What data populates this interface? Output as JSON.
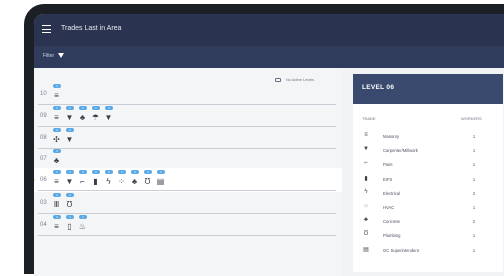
{
  "header": {
    "title": "Trades Last in Area"
  },
  "filter": {
    "label": "Filter",
    "icon": "filter-icon"
  },
  "legend": {
    "no_work_label": "No Active Levels",
    "icon": "no-work-icon"
  },
  "accent": {
    "marker": "#f2a516",
    "badge": "#5aa9e6",
    "header": "#2a3451"
  },
  "floors": [
    {
      "level": "10",
      "active": false,
      "trades": [
        {
          "count": "1",
          "glyph": "≡",
          "icon": "masonry-icon"
        }
      ]
    },
    {
      "level": "09",
      "active": false,
      "trades": [
        {
          "count": "1",
          "glyph": "≡",
          "icon": "masonry-icon"
        },
        {
          "count": "1",
          "glyph": "▼",
          "icon": "carpenter-icon"
        },
        {
          "count": "1",
          "glyph": "♣",
          "icon": "concrete-icon"
        },
        {
          "count": "1",
          "glyph": "☂",
          "icon": "hvac-icon"
        },
        {
          "count": "1",
          "glyph": "▼",
          "icon": "carpenter-icon"
        }
      ]
    },
    {
      "level": "08",
      "active": false,
      "trades": [
        {
          "count": "1",
          "glyph": "✣",
          "icon": "hvac-icon"
        },
        {
          "count": "1",
          "glyph": "▼",
          "icon": "carpenter-icon"
        }
      ]
    },
    {
      "level": "07",
      "active": false,
      "trades": [
        {
          "count": "1",
          "glyph": "♣",
          "icon": "concrete-icon"
        }
      ]
    },
    {
      "level": "06",
      "active": true,
      "trades": [
        {
          "count": "1",
          "glyph": "≡",
          "icon": "masonry-icon"
        },
        {
          "count": "1",
          "glyph": "▼",
          "icon": "carpenter-icon"
        },
        {
          "count": "1",
          "glyph": "⌐",
          "icon": "paint-icon"
        },
        {
          "count": "1",
          "glyph": "▮",
          "icon": "eifs-icon"
        },
        {
          "count": "2",
          "glyph": "ϟ",
          "icon": "electrical-icon"
        },
        {
          "count": "1",
          "glyph": "⁘",
          "icon": "hvac-icon"
        },
        {
          "count": "2",
          "glyph": "♣",
          "icon": "concrete-icon"
        },
        {
          "count": "1",
          "glyph": "Ʊ",
          "icon": "plumbing-icon"
        },
        {
          "count": "1",
          "glyph": "▤",
          "icon": "superintendent-icon"
        }
      ]
    },
    {
      "level": "03",
      "active": false,
      "trades": [
        {
          "count": "1",
          "glyph": "Ⅲ",
          "icon": "scaffold-icon"
        },
        {
          "count": "1",
          "glyph": "Ʊ",
          "icon": "plumbing-icon"
        }
      ]
    },
    {
      "level": "04",
      "active": false,
      "trades": [
        {
          "count": "1",
          "glyph": "≡",
          "icon": "masonry-icon"
        },
        {
          "count": "1",
          "glyph": "▯",
          "icon": "door-icon"
        },
        {
          "count": "1",
          "glyph": "♨",
          "icon": "roofing-icon"
        }
      ]
    }
  ],
  "panel": {
    "title": "LEVEL 06",
    "col_trade": "TRADE",
    "col_workers": "WORKERS",
    "rows": [
      {
        "glyph": "≡",
        "icon": "masonry-icon",
        "name": "Masonry",
        "workers": "1"
      },
      {
        "glyph": "▼",
        "icon": "carpenter-icon",
        "name": "Carpenter/Millwork",
        "workers": "1"
      },
      {
        "glyph": "⌐",
        "icon": "paint-icon",
        "name": "Paint",
        "workers": "1"
      },
      {
        "glyph": "▮",
        "icon": "eifs-icon",
        "name": "EIFS",
        "workers": "1"
      },
      {
        "glyph": "ϟ",
        "icon": "electrical-icon",
        "name": "Electrical",
        "workers": "2"
      },
      {
        "glyph": "⁘",
        "icon": "hvac-icon",
        "name": "HVAC",
        "workers": "1"
      },
      {
        "glyph": "♣",
        "icon": "concrete-icon",
        "name": "Concrete",
        "workers": "2"
      },
      {
        "glyph": "Ʊ",
        "icon": "plumbing-icon",
        "name": "Plumbing",
        "workers": "1"
      },
      {
        "glyph": "▤",
        "icon": "superintendent-icon",
        "name": "GC Superintendent",
        "workers": "1"
      }
    ]
  }
}
